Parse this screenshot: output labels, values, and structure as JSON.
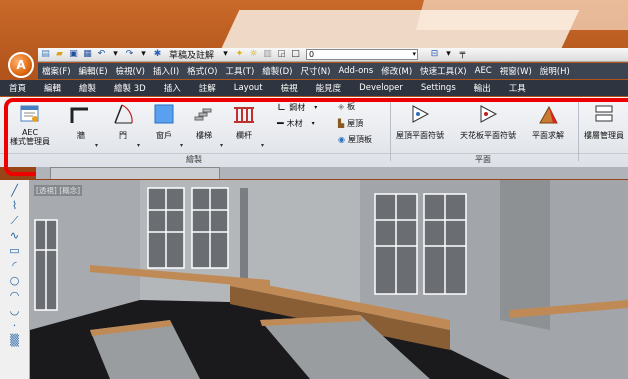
{
  "quick_access": {
    "style_selector": "草稿及註解",
    "layer_value": "0"
  },
  "menu": {
    "items": [
      "檔案(F)",
      "編輯(E)",
      "檢視(V)",
      "插入(I)",
      "格式(O)",
      "工具(T)",
      "繪製(D)",
      "尺寸(N)",
      "Add-ons",
      "修改(M)",
      "快速工具(X)",
      "AEC",
      "視窗(W)",
      "說明(H)"
    ]
  },
  "ribbon_tabs": [
    "首頁",
    "編輯",
    "繪製",
    "繪製 3D",
    "插入",
    "註解",
    "Layout",
    "檢視",
    "能見度",
    "Developer",
    "Settings",
    "輸出",
    "工具"
  ],
  "ribbon": {
    "draw_group": {
      "label": "繪製",
      "aec_style_manager_line1": "AEC",
      "aec_style_manager_line2": "樣式管理員",
      "wall": "牆",
      "door": "門",
      "window": "窗戶",
      "stair": "樓梯",
      "railing": "欄杆",
      "column": "鋼材",
      "beam": "木材",
      "slab": "板",
      "roof": "屋頂",
      "roof_slab": "屋頂板"
    },
    "plane_group": {
      "label": "平面",
      "roof_plane_symbol": "屋頂平面符號",
      "ceiling_plane_symbol": "天花板平面符號",
      "plane_solve": "平面求解"
    },
    "floor_group": {
      "floor_manager": "樓層管理員"
    }
  },
  "viewport": {
    "view_label": "[透視] [概念]"
  }
}
